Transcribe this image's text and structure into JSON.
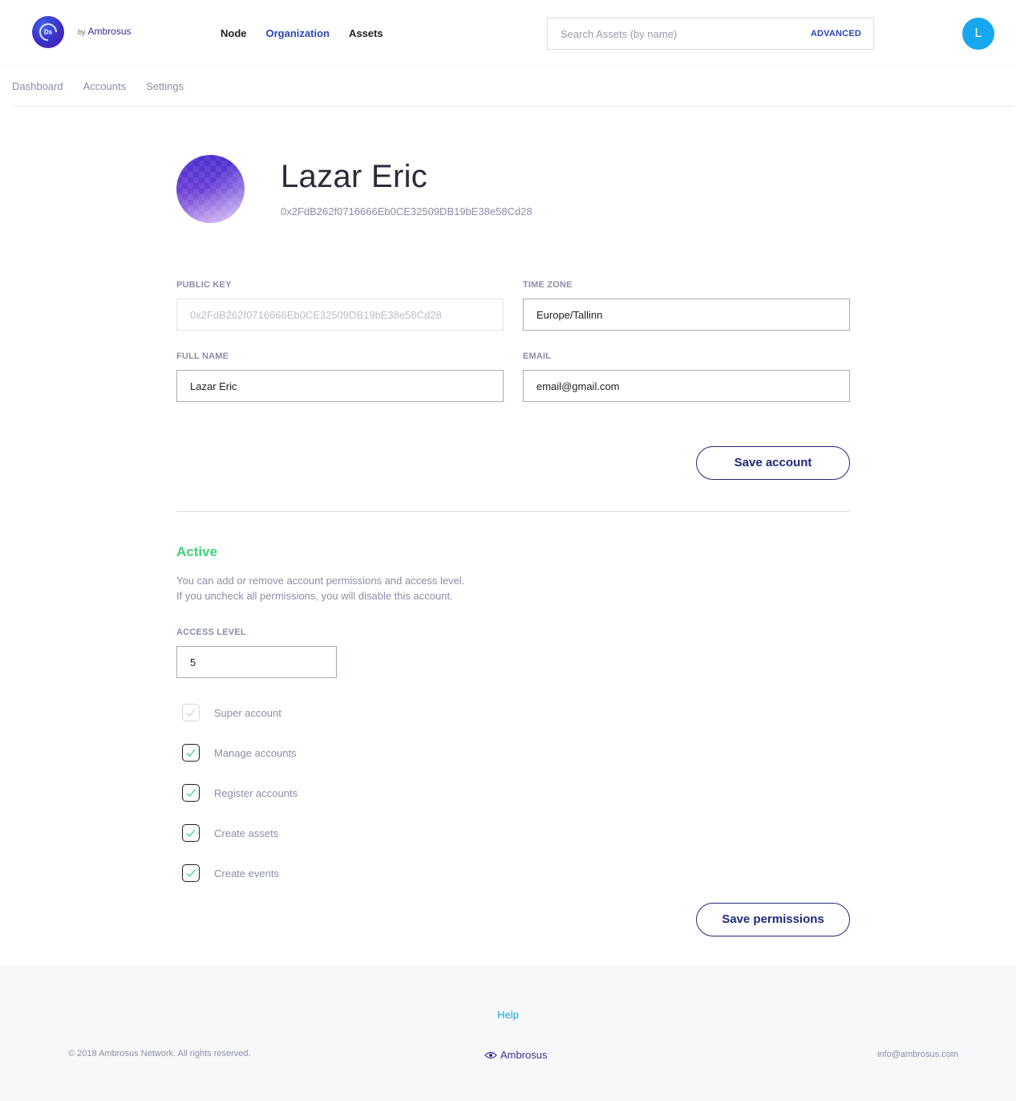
{
  "header": {
    "logo_text": "Ds",
    "by_label": "by",
    "brand": "Ambrosus",
    "nav": [
      {
        "label": "Node"
      },
      {
        "label": "Organization",
        "active": true
      },
      {
        "label": "Assets"
      }
    ],
    "search_placeholder": "Search Assets (by name)",
    "search_advanced": "ADVANCED",
    "user_initial": "L"
  },
  "subnav": [
    "Dashboard",
    "Accounts",
    "Settings"
  ],
  "profile": {
    "name": "Lazar Eric",
    "address": "0x2FdB262f0716666Eb0CE32509DB19bE38e58Cd28"
  },
  "form": {
    "public_key_label": "PUBLIC KEY",
    "public_key_value": "0x2FdB262f0716666Eb0CE32509DB19bE38e58Cd28",
    "time_zone_label": "TIME ZONE",
    "time_zone_value": "Europe/Tallinn",
    "full_name_label": "FULL NAME",
    "full_name_value": "Lazar Eric",
    "email_label": "EMAIL",
    "email_value": "email@gmail.com",
    "save_account": "Save account"
  },
  "permissions": {
    "status": "Active",
    "desc_line1": "You can add or remove account permissions and access level.",
    "desc_line2": "If you uncheck all permissions, you will disable this account.",
    "access_level_label": "ACCESS LEVEL",
    "access_level_value": "5",
    "items": [
      {
        "label": "Super account",
        "checked": true,
        "disabled": true
      },
      {
        "label": "Manage accounts",
        "checked": true
      },
      {
        "label": "Register accounts",
        "checked": true
      },
      {
        "label": "Create assets",
        "checked": true
      },
      {
        "label": "Create events",
        "checked": true
      }
    ],
    "save_permissions": "Save permissions"
  },
  "footer": {
    "help": "Help",
    "copyright": "© 2018 Ambrosus Network. All rights reserved.",
    "brand": "Ambrosus",
    "email": "info@ambrosus.com"
  },
  "colors": {
    "accent": "#2a47b8",
    "button_border": "#1e2a78",
    "status_active": "#3ed47c",
    "avatar_bg": "#16a7ee",
    "check_mark": "#3ed47c"
  }
}
